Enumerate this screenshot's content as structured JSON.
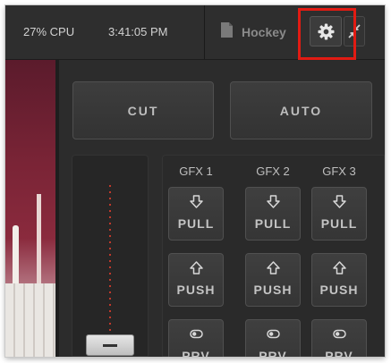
{
  "topbar": {
    "cpu": "27% CPU",
    "time": "3:41:05 PM",
    "document_title": "Hockey"
  },
  "switcher": {
    "cut_label": "CUT",
    "auto_label": "AUTO"
  },
  "gfx": [
    {
      "label": "GFX 1",
      "pull": "PULL",
      "push": "PUSH",
      "prv": "PRV"
    },
    {
      "label": "GFX 2",
      "pull": "PULL",
      "push": "PUSH",
      "prv": "PRV"
    },
    {
      "label": "GFX 3",
      "pull": "PULL",
      "push": "PUSH",
      "prv": "PRV"
    }
  ],
  "colors": {
    "highlight": "#e21b13",
    "tbar_dots": "#c0392b",
    "panel_bg": "#2c2c2c"
  },
  "icons": {
    "settings": "gear-icon",
    "collapse": "collapse-arrows-icon",
    "document": "document-icon",
    "pull": "arrow-down-outline-icon",
    "push": "arrow-up-outline-icon",
    "prv": "toggle-icon"
  }
}
